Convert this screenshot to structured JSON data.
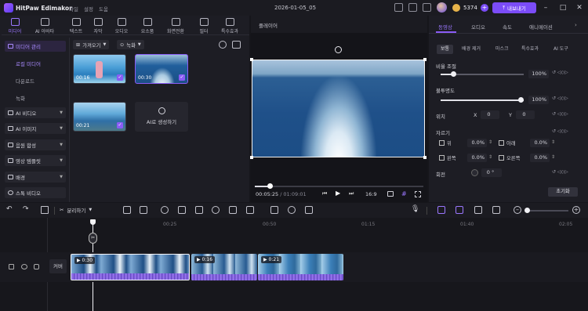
{
  "app": {
    "name": "HitPaw Edimakor",
    "project_title": "2026-01-05_05"
  },
  "menus": [
    "파일",
    "설정",
    "도움"
  ],
  "account": {
    "credits": "5374",
    "export_label": "내보내기"
  },
  "tool_tabs": [
    {
      "label": "미디어",
      "icon": "media-icon",
      "active": true
    },
    {
      "label": "AI 아바타",
      "icon": "avatar-icon"
    },
    {
      "label": "텍스트",
      "icon": "text-icon"
    },
    {
      "label": "자막",
      "icon": "subtitle-icon"
    },
    {
      "label": "오디오",
      "icon": "audio-icon"
    },
    {
      "label": "요소품",
      "icon": "sticker-icon"
    },
    {
      "label": "화면전환",
      "icon": "transition-icon"
    },
    {
      "label": "필터",
      "icon": "filter-icon"
    },
    {
      "label": "특수효과",
      "icon": "effects-icon"
    }
  ],
  "sidebar": {
    "media_section": "미디어 관리",
    "sub_items": [
      "로컬 미디어",
      "다운로드",
      "녹화"
    ],
    "items": [
      "AI 비디오",
      "AI 이미지",
      "음원 합성",
      "영상 템플릿",
      "배경",
      "스톡 비디오"
    ]
  },
  "media_toolbar": {
    "import_label": "가져오기",
    "record_label": "녹화"
  },
  "media": [
    {
      "duration": "00:16"
    },
    {
      "duration": "00:30"
    },
    {
      "duration": "00:21"
    }
  ],
  "ai_generate": {
    "label": "AI로 생성하기"
  },
  "player": {
    "label": "플레이어",
    "current_time": "00:05:25",
    "total_time": "01:09:01",
    "ratio": "16:9"
  },
  "right_panel": {
    "tabs": [
      "동영상",
      "오디오",
      "속도",
      "애니메이션"
    ],
    "sub_tabs": [
      "보통",
      "배경 제거",
      "마스크",
      "특수효과",
      "AI 도구"
    ],
    "volume": {
      "label": "비율 조절",
      "value": "100%"
    },
    "opacity": {
      "label": "불투명도",
      "value": "100%"
    },
    "position": {
      "label": "위치",
      "x_label": "X",
      "x_value": "0",
      "y_label": "Y",
      "y_value": "0"
    },
    "crop": {
      "label": "자르기",
      "top_label": "위",
      "top_value": "0.0%",
      "bottom_label": "아래",
      "bottom_value": "0.0%",
      "left_label": "왼쪽",
      "left_value": "0.0%",
      "right_label": "오른쪽",
      "right_value": "0.0%"
    },
    "rotate": {
      "label": "회전",
      "value": "0",
      "unit": "°"
    },
    "reset_label": "초기화"
  },
  "toolbar": {
    "split_label": "분리하기"
  },
  "timeline": {
    "ticks": [
      "00:25",
      "00:50",
      "01:15",
      "01:40",
      "02:05"
    ],
    "track_label": "커버",
    "clips": [
      {
        "duration": "0:30"
      },
      {
        "duration": "0:16"
      },
      {
        "duration": "0:21"
      }
    ]
  },
  "colors": {
    "accent": "#7b4cf8",
    "panel": "#1d1d24",
    "background": "#16161b"
  }
}
